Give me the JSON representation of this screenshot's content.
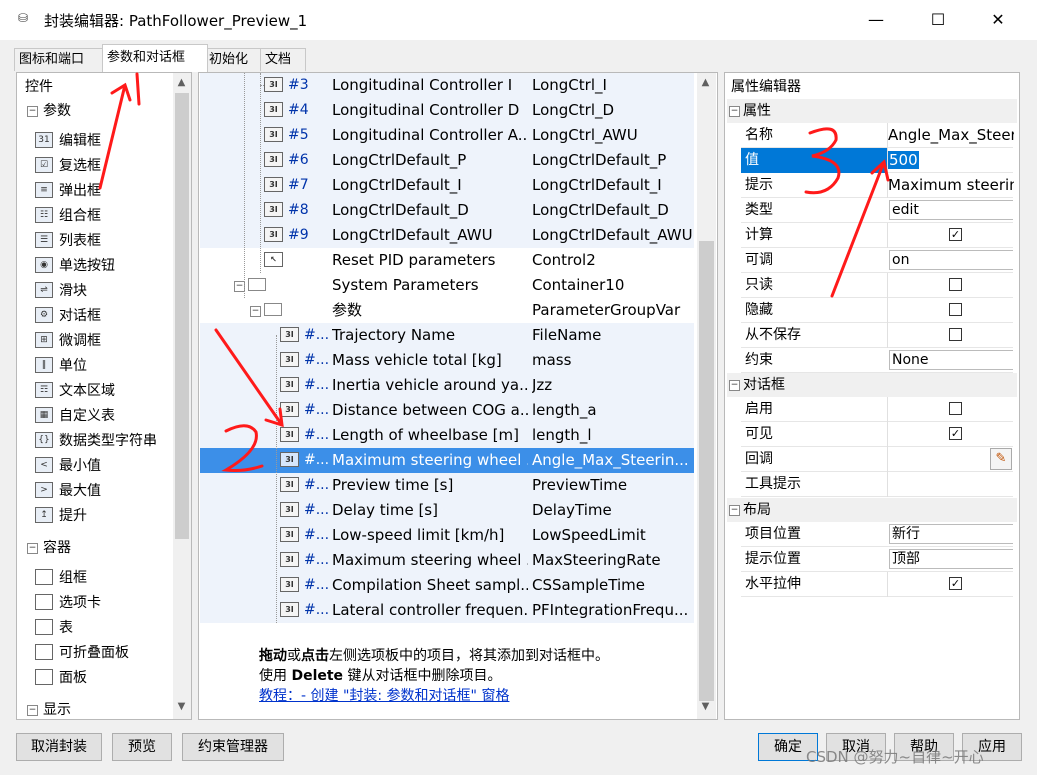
{
  "window": {
    "title": "封装编辑器: PathFollower_Preview_1",
    "minimize": "—",
    "maximize": "☐",
    "close": "✕"
  },
  "tabs": [
    {
      "label": "图标和端口",
      "active": false
    },
    {
      "label": "参数和对话框",
      "active": true
    },
    {
      "label": "初始化",
      "active": false
    },
    {
      "label": "文档",
      "active": false
    }
  ],
  "controls_panel": {
    "header": "控件",
    "groups": [
      {
        "label": "参数",
        "items": [
          "编辑框",
          "复选框",
          "弹出框",
          "组合框",
          "列表框",
          "单选按钮",
          "滑块",
          "对话框",
          "微调框",
          "单位",
          "文本区域",
          "自定义表",
          "数据类型字符串",
          "最小值",
          "最大值",
          "提升"
        ]
      },
      {
        "label": "容器",
        "items": [
          "组框",
          "选项卡",
          "表",
          "可折叠面板",
          "面板"
        ]
      },
      {
        "label": "显示",
        "items": []
      }
    ]
  },
  "tree": {
    "rows": [
      {
        "num": "#3",
        "prompt": "Longitudinal Controller I",
        "name": "LongCtrl_I"
      },
      {
        "num": "#4",
        "prompt": "Longitudinal Controller D",
        "name": "LongCtrl_D"
      },
      {
        "num": "#5",
        "prompt": "Longitudinal Controller A...",
        "name": "LongCtrl_AWU"
      },
      {
        "num": "#6",
        "prompt": "LongCtrlDefault_P",
        "name": "LongCtrlDefault_P"
      },
      {
        "num": "#7",
        "prompt": "LongCtrlDefault_I",
        "name": "LongCtrlDefault_I"
      },
      {
        "num": "#8",
        "prompt": "LongCtrlDefault_D",
        "name": "LongCtrlDefault_D"
      },
      {
        "num": "#9",
        "prompt": "LongCtrlDefault_AWU",
        "name": "LongCtrlDefault_AWU"
      },
      {
        "num": "",
        "prompt": "Reset PID parameters",
        "name": "Control2"
      },
      {
        "num": "",
        "prompt": "System Parameters",
        "name": "Container10"
      },
      {
        "num": "",
        "prompt": "参数",
        "name": "ParameterGroupVar"
      },
      {
        "num": "#...",
        "prompt": "Trajectory Name",
        "name": "FileName"
      },
      {
        "num": "#...",
        "prompt": "Mass vehicle total [kg]",
        "name": "mass"
      },
      {
        "num": "#...",
        "prompt": "Inertia vehicle around ya...",
        "name": "Jzz"
      },
      {
        "num": "#...",
        "prompt": "Distance between COG a...",
        "name": "length_a"
      },
      {
        "num": "#...",
        "prompt": "Length of wheelbase [m]",
        "name": "length_l"
      },
      {
        "num": "#...",
        "prompt": "Maximum steering wheel ...",
        "name": "Angle_Max_Steerin..."
      },
      {
        "num": "#...",
        "prompt": "Preview time [s]",
        "name": "PreviewTime"
      },
      {
        "num": "#...",
        "prompt": "Delay time [s]",
        "name": "DelayTime"
      },
      {
        "num": "#...",
        "prompt": "Low-speed limit [km/h]",
        "name": "LowSpeedLimit"
      },
      {
        "num": "#...",
        "prompt": "Maximum steering wheel ...",
        "name": "MaxSteeringRate"
      },
      {
        "num": "#...",
        "prompt": "Compilation Sheet sampl...",
        "name": "CSSampleTime"
      },
      {
        "num": "#...",
        "prompt": "Lateral controller frequen...",
        "name": "PFIntegrationFrequ..."
      }
    ],
    "selected_index": 15,
    "icon_text": "3"
  },
  "help": {
    "line1_bold1": "拖动",
    "line1_mid": "或",
    "line1_bold2": "点击",
    "line1_rest": "左侧选项板中的项目，将其添加到对话框中。",
    "line2_pre": "使用 ",
    "line2_bold": "Delete",
    "line2_rest": " 键从对话框中删除项目。",
    "link": "教程：- 创建 \"封装: 参数和对话框\" 窗格"
  },
  "props": {
    "header": "属性编辑器",
    "sections": {
      "attributes": "属性",
      "dialog": "对话框",
      "layout": "布局"
    },
    "rows": {
      "name_label": "名称",
      "name_value": "Angle_Max_Steer...",
      "value_label": "值",
      "value_value": "500",
      "prompt_label": "提示",
      "prompt_value": "Maximum steerin...",
      "type_label": "类型",
      "type_value": "edit",
      "evaluate_label": "计算",
      "evaluate_checked": true,
      "tunable_label": "可调",
      "tunable_value": "on",
      "readonly_label": "只读",
      "readonly_checked": false,
      "hidden_label": "隐藏",
      "hidden_checked": false,
      "neversave_label": "从不保存",
      "neversave_checked": false,
      "constraint_label": "约束",
      "constraint_value": "None",
      "enable_label": "启用",
      "enable_checked": false,
      "visible_label": "可见",
      "visible_checked": true,
      "callback_label": "回调",
      "tooltip_label": "工具提示",
      "itemloc_label": "项目位置",
      "itemloc_value": "新行",
      "promptloc_label": "提示位置",
      "promptloc_value": "顶部",
      "hstretch_label": "水平拉伸",
      "hstretch_checked": true
    }
  },
  "buttons": {
    "unmask": "取消封装",
    "preview": "预览",
    "constraint_manager": "约束管理器",
    "ok": "确定",
    "cancel": "取消",
    "help": "帮助",
    "apply": "应用"
  },
  "watermark": "CSDN @努力~自律~开心",
  "colors": {
    "selection": "#3c8fe8",
    "annotation": "#ff1a1a",
    "link": "#0033cc"
  }
}
